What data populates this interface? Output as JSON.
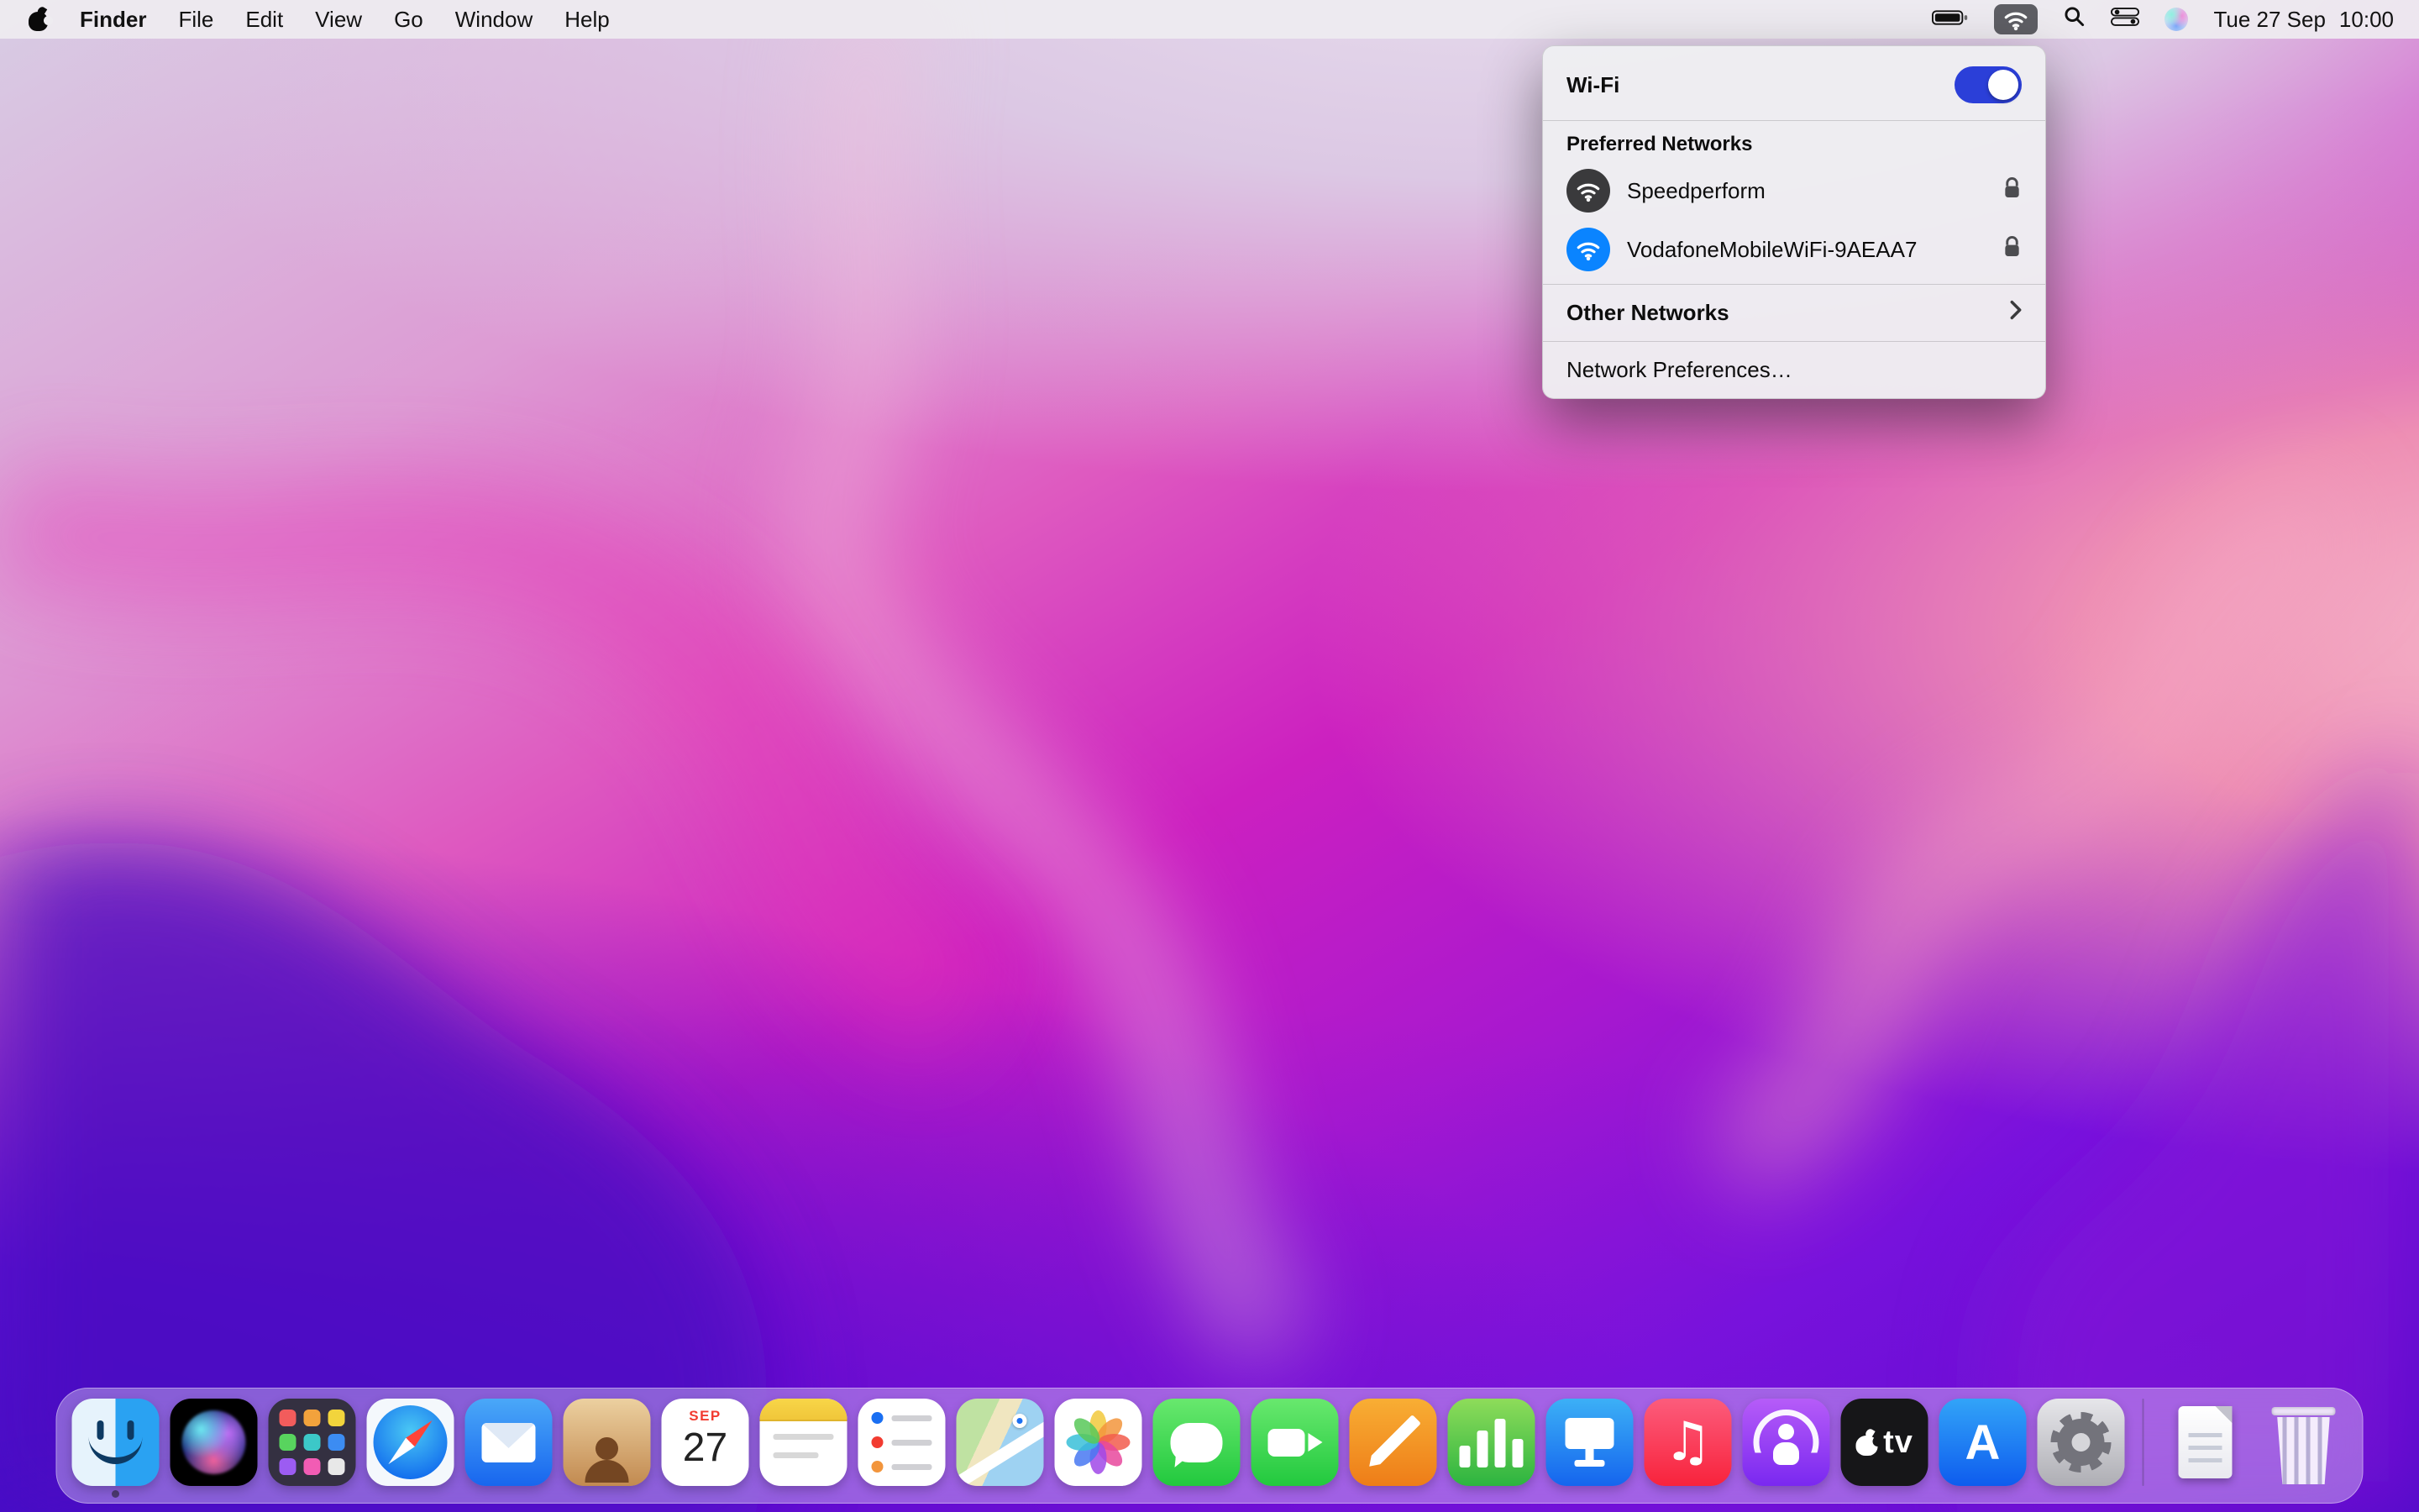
{
  "menu_bar": {
    "app_name": "Finder",
    "menus": [
      "File",
      "Edit",
      "View",
      "Go",
      "Window",
      "Help"
    ],
    "status": {
      "date": "Tue 27 Sep",
      "time": "10:00"
    }
  },
  "wifi_menu": {
    "title": "Wi-Fi",
    "toggle_on": true,
    "preferred_header": "Preferred Networks",
    "networks": [
      {
        "name": "Speedperform",
        "locked": true,
        "active": false
      },
      {
        "name": "VodafoneMobileWiFi-9AEAA7",
        "locked": true,
        "active": true
      }
    ],
    "other_networks_label": "Other Networks",
    "network_preferences_label": "Network Preferences…"
  },
  "dock": {
    "items": [
      "finder",
      "siri",
      "launchpad",
      "safari",
      "mail",
      "contacts",
      "calendar",
      "notes",
      "reminders",
      "maps",
      "photos",
      "messages",
      "facetime",
      "pages",
      "numbers",
      "keynote",
      "music",
      "podcasts",
      "apple-tv",
      "app-store",
      "system-preferences",
      "documents",
      "trash"
    ],
    "calendar": {
      "month": "SEP",
      "day": "27"
    },
    "glyphs": {
      "music_note": "♫",
      "apple_tv_label": "tv",
      "app_store_letter": "A"
    }
  },
  "colors": {
    "accent_blue": "#0a84ff",
    "toggle_blue": "#2b3fd8",
    "network_icon_gray": "#3a3a3c"
  }
}
